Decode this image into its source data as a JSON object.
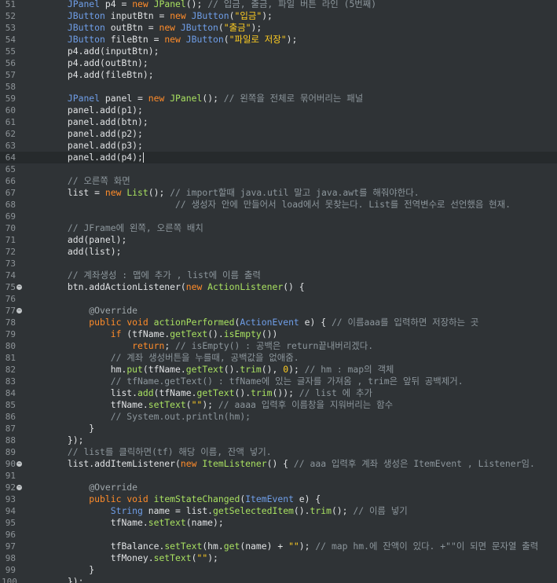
{
  "editor": {
    "lines": [
      {
        "n": "51",
        "fold": false,
        "tokens": [
          [
            "pl",
            "        "
          ],
          [
            "ty",
            "JPanel"
          ],
          [
            "pl",
            " p4 = "
          ],
          [
            "kw",
            "new"
          ],
          [
            "pl",
            " "
          ],
          [
            "fn",
            "JPanel"
          ],
          [
            "pl",
            "(); "
          ],
          [
            "cm",
            "// 입금, 출금, 파일 버튼 라인 (5번째)"
          ]
        ]
      },
      {
        "n": "52",
        "fold": false,
        "tokens": [
          [
            "pl",
            "        "
          ],
          [
            "ty",
            "JButton"
          ],
          [
            "pl",
            " inputBtn = "
          ],
          [
            "kw",
            "new"
          ],
          [
            "pl",
            " "
          ],
          [
            "ty",
            "JButton"
          ],
          [
            "pl",
            "("
          ],
          [
            "st",
            "\"입금\""
          ],
          [
            "pl",
            ");"
          ]
        ]
      },
      {
        "n": "53",
        "fold": false,
        "tokens": [
          [
            "pl",
            "        "
          ],
          [
            "ty",
            "JButton"
          ],
          [
            "pl",
            " outBtn = "
          ],
          [
            "kw",
            "new"
          ],
          [
            "pl",
            " "
          ],
          [
            "ty",
            "JButton"
          ],
          [
            "pl",
            "("
          ],
          [
            "st",
            "\"출금\""
          ],
          [
            "pl",
            ");"
          ]
        ]
      },
      {
        "n": "54",
        "fold": false,
        "tokens": [
          [
            "pl",
            "        "
          ],
          [
            "ty",
            "JButton"
          ],
          [
            "pl",
            " fileBtn = "
          ],
          [
            "kw",
            "new"
          ],
          [
            "pl",
            " "
          ],
          [
            "ty",
            "JButton"
          ],
          [
            "pl",
            "("
          ],
          [
            "st",
            "\"파일로 저장\""
          ],
          [
            "pl",
            ");"
          ]
        ]
      },
      {
        "n": "55",
        "fold": false,
        "tokens": [
          [
            "pl",
            "        p4.add(inputBtn);"
          ]
        ]
      },
      {
        "n": "56",
        "fold": false,
        "tokens": [
          [
            "pl",
            "        p4.add(outBtn);"
          ]
        ]
      },
      {
        "n": "57",
        "fold": false,
        "tokens": [
          [
            "pl",
            "        p4.add(fileBtn);"
          ]
        ]
      },
      {
        "n": "58",
        "fold": false,
        "tokens": []
      },
      {
        "n": "59",
        "fold": false,
        "tokens": [
          [
            "pl",
            "        "
          ],
          [
            "ty",
            "JPanel"
          ],
          [
            "pl",
            " panel = "
          ],
          [
            "kw",
            "new"
          ],
          [
            "pl",
            " "
          ],
          [
            "fn",
            "JPanel"
          ],
          [
            "pl",
            "(); "
          ],
          [
            "cm",
            "// 왼쪽을 전체로 묶어버리는 패널"
          ]
        ]
      },
      {
        "n": "60",
        "fold": false,
        "tokens": [
          [
            "pl",
            "        panel.add(p1);"
          ]
        ]
      },
      {
        "n": "61",
        "fold": false,
        "tokens": [
          [
            "pl",
            "        panel.add(btn);"
          ]
        ]
      },
      {
        "n": "62",
        "fold": false,
        "tokens": [
          [
            "pl",
            "        panel.add(p2);"
          ]
        ]
      },
      {
        "n": "63",
        "fold": false,
        "tokens": [
          [
            "pl",
            "        panel.add(p3);"
          ]
        ]
      },
      {
        "n": "64",
        "fold": false,
        "current": true,
        "caret": true,
        "tokens": [
          [
            "pl",
            "        panel.add(p4);"
          ]
        ]
      },
      {
        "n": "65",
        "fold": false,
        "tokens": []
      },
      {
        "n": "66",
        "fold": false,
        "tokens": [
          [
            "pl",
            "        "
          ],
          [
            "cm",
            "// 오른쪽 화면"
          ]
        ]
      },
      {
        "n": "67",
        "fold": false,
        "tokens": [
          [
            "pl",
            "        list = "
          ],
          [
            "kw",
            "new"
          ],
          [
            "pl",
            " "
          ],
          [
            "fn",
            "List"
          ],
          [
            "pl",
            "(); "
          ],
          [
            "cm",
            "// import할때 java.util 말고 java.awt를 해줘야한다."
          ]
        ]
      },
      {
        "n": "68",
        "fold": false,
        "tokens": [
          [
            "cm",
            "                            // 생성자 안에 만들어서 load에서 못찾는다. List를 전역변수로 선언했음 현재."
          ]
        ]
      },
      {
        "n": "69",
        "fold": false,
        "tokens": []
      },
      {
        "n": "70",
        "fold": false,
        "tokens": [
          [
            "pl",
            "        "
          ],
          [
            "cm",
            "// JFrame에 왼쪽, 오른쪽 배치"
          ]
        ]
      },
      {
        "n": "71",
        "fold": false,
        "tokens": [
          [
            "pl",
            "        add(panel);"
          ]
        ]
      },
      {
        "n": "72",
        "fold": false,
        "tokens": [
          [
            "pl",
            "        add(list);"
          ]
        ]
      },
      {
        "n": "73",
        "fold": false,
        "tokens": []
      },
      {
        "n": "74",
        "fold": false,
        "tokens": [
          [
            "pl",
            "        "
          ],
          [
            "cm",
            "// 계좌생성 : 맵에 추가 , list에 이름 출력"
          ]
        ]
      },
      {
        "n": "75",
        "fold": true,
        "tokens": [
          [
            "pl",
            "        btn.addActionListener("
          ],
          [
            "kw",
            "new"
          ],
          [
            "pl",
            " "
          ],
          [
            "fn",
            "ActionListener"
          ],
          [
            "pl",
            "() {"
          ]
        ]
      },
      {
        "n": "76",
        "fold": false,
        "tokens": []
      },
      {
        "n": "77",
        "fold": true,
        "tokens": [
          [
            "pl",
            "            "
          ],
          [
            "an",
            "@Override"
          ]
        ]
      },
      {
        "n": "78",
        "fold": false,
        "tokens": [
          [
            "pl",
            "            "
          ],
          [
            "kw",
            "public"
          ],
          [
            "pl",
            " "
          ],
          [
            "kw",
            "void"
          ],
          [
            "pl",
            " "
          ],
          [
            "fn",
            "actionPerformed"
          ],
          [
            "pl",
            "("
          ],
          [
            "ty",
            "ActionEvent"
          ],
          [
            "pl",
            " e) { "
          ],
          [
            "cm",
            "// 이름aaa를 입력하면 저장하는 곳"
          ]
        ]
      },
      {
        "n": "79",
        "fold": false,
        "tokens": [
          [
            "pl",
            "                "
          ],
          [
            "kw",
            "if"
          ],
          [
            "pl",
            " (tfName."
          ],
          [
            "fn",
            "getText"
          ],
          [
            "pl",
            "()."
          ],
          [
            "fn",
            "isEmpty"
          ],
          [
            "pl",
            "())"
          ]
        ]
      },
      {
        "n": "80",
        "fold": false,
        "tokens": [
          [
            "pl",
            "                    "
          ],
          [
            "kw",
            "return"
          ],
          [
            "pl",
            "; "
          ],
          [
            "cm",
            "// isEmpty() : 공백은 return끝내버리겠다."
          ]
        ]
      },
      {
        "n": "81",
        "fold": false,
        "tokens": [
          [
            "pl",
            "                "
          ],
          [
            "cm",
            "// 계좌 생성버튼을 누를때, 공백값을 없애줌."
          ]
        ]
      },
      {
        "n": "82",
        "fold": false,
        "tokens": [
          [
            "pl",
            "                hm."
          ],
          [
            "fn",
            "put"
          ],
          [
            "pl",
            "(tfName."
          ],
          [
            "fn",
            "getText"
          ],
          [
            "pl",
            "()."
          ],
          [
            "fn",
            "trim"
          ],
          [
            "pl",
            "(), "
          ],
          [
            "nu",
            "0"
          ],
          [
            "pl",
            "); "
          ],
          [
            "cm",
            "// hm : map의 객체"
          ]
        ]
      },
      {
        "n": "83",
        "fold": false,
        "tokens": [
          [
            "pl",
            "                "
          ],
          [
            "cm",
            "// tfName.getText() : tfName에 있는 글자를 가져옴 , trim은 앞뒤 공백제거."
          ]
        ]
      },
      {
        "n": "84",
        "fold": false,
        "tokens": [
          [
            "pl",
            "                list."
          ],
          [
            "fn",
            "add"
          ],
          [
            "pl",
            "(tfName."
          ],
          [
            "fn",
            "getText"
          ],
          [
            "pl",
            "()."
          ],
          [
            "fn",
            "trim"
          ],
          [
            "pl",
            "()); "
          ],
          [
            "cm",
            "// list 에 추가"
          ]
        ]
      },
      {
        "n": "85",
        "fold": false,
        "tokens": [
          [
            "pl",
            "                tfName."
          ],
          [
            "fn",
            "setText"
          ],
          [
            "pl",
            "("
          ],
          [
            "st",
            "\"\""
          ],
          [
            "pl",
            "); "
          ],
          [
            "cm",
            "// aaaa 입력후 이름창을 지워버리는 함수"
          ]
        ]
      },
      {
        "n": "86",
        "fold": false,
        "tokens": [
          [
            "pl",
            "                "
          ],
          [
            "cm",
            "// System.out.println(hm);"
          ]
        ]
      },
      {
        "n": "87",
        "fold": false,
        "tokens": [
          [
            "pl",
            "            }"
          ]
        ]
      },
      {
        "n": "88",
        "fold": false,
        "tokens": [
          [
            "pl",
            "        });"
          ]
        ]
      },
      {
        "n": "89",
        "fold": false,
        "tokens": [
          [
            "pl",
            "        "
          ],
          [
            "cm",
            "// list를 클릭하면(tf) 해당 이름, 잔액 넣기."
          ]
        ]
      },
      {
        "n": "90",
        "fold": true,
        "tokens": [
          [
            "pl",
            "        list.addItemListener("
          ],
          [
            "kw",
            "new"
          ],
          [
            "pl",
            " "
          ],
          [
            "fn",
            "ItemListener"
          ],
          [
            "pl",
            "() { "
          ],
          [
            "cm",
            "// aaa 입력후 계좌 생성은 ItemEvent , Listener임."
          ]
        ]
      },
      {
        "n": "91",
        "fold": false,
        "tokens": []
      },
      {
        "n": "92",
        "fold": true,
        "tokens": [
          [
            "pl",
            "            "
          ],
          [
            "an",
            "@Override"
          ]
        ]
      },
      {
        "n": "93",
        "fold": false,
        "tokens": [
          [
            "pl",
            "            "
          ],
          [
            "kw",
            "public"
          ],
          [
            "pl",
            " "
          ],
          [
            "kw",
            "void"
          ],
          [
            "pl",
            " "
          ],
          [
            "fn",
            "itemStateChanged"
          ],
          [
            "pl",
            "("
          ],
          [
            "ty",
            "ItemEvent"
          ],
          [
            "pl",
            " e) {"
          ]
        ]
      },
      {
        "n": "94",
        "fold": false,
        "tokens": [
          [
            "pl",
            "                "
          ],
          [
            "ty",
            "String"
          ],
          [
            "pl",
            " name = list."
          ],
          [
            "fn",
            "getSelectedItem"
          ],
          [
            "pl",
            "()."
          ],
          [
            "fn",
            "trim"
          ],
          [
            "pl",
            "(); "
          ],
          [
            "cm",
            "// 이름 넣기"
          ]
        ]
      },
      {
        "n": "95",
        "fold": false,
        "tokens": [
          [
            "pl",
            "                tfName."
          ],
          [
            "fn",
            "setText"
          ],
          [
            "pl",
            "(name);"
          ]
        ]
      },
      {
        "n": "96",
        "fold": false,
        "tokens": []
      },
      {
        "n": "97",
        "fold": false,
        "tokens": [
          [
            "pl",
            "                tfBalance."
          ],
          [
            "fn",
            "setText"
          ],
          [
            "pl",
            "(hm."
          ],
          [
            "fn",
            "get"
          ],
          [
            "pl",
            "(name) + "
          ],
          [
            "st",
            "\"\""
          ],
          [
            "pl",
            "); "
          ],
          [
            "cm",
            "// map hm.에 잔액이 있다. +\"\"이 되면 문자열 출력"
          ]
        ]
      },
      {
        "n": "98",
        "fold": false,
        "tokens": [
          [
            "pl",
            "                tfMoney."
          ],
          [
            "fn",
            "setText"
          ],
          [
            "pl",
            "("
          ],
          [
            "st",
            "\"\""
          ],
          [
            "pl",
            ");"
          ]
        ]
      },
      {
        "n": "99",
        "fold": false,
        "tokens": [
          [
            "pl",
            "            }"
          ]
        ]
      },
      {
        "n": "100",
        "fold": false,
        "tokens": [
          [
            "pl",
            "        });"
          ]
        ]
      }
    ]
  }
}
